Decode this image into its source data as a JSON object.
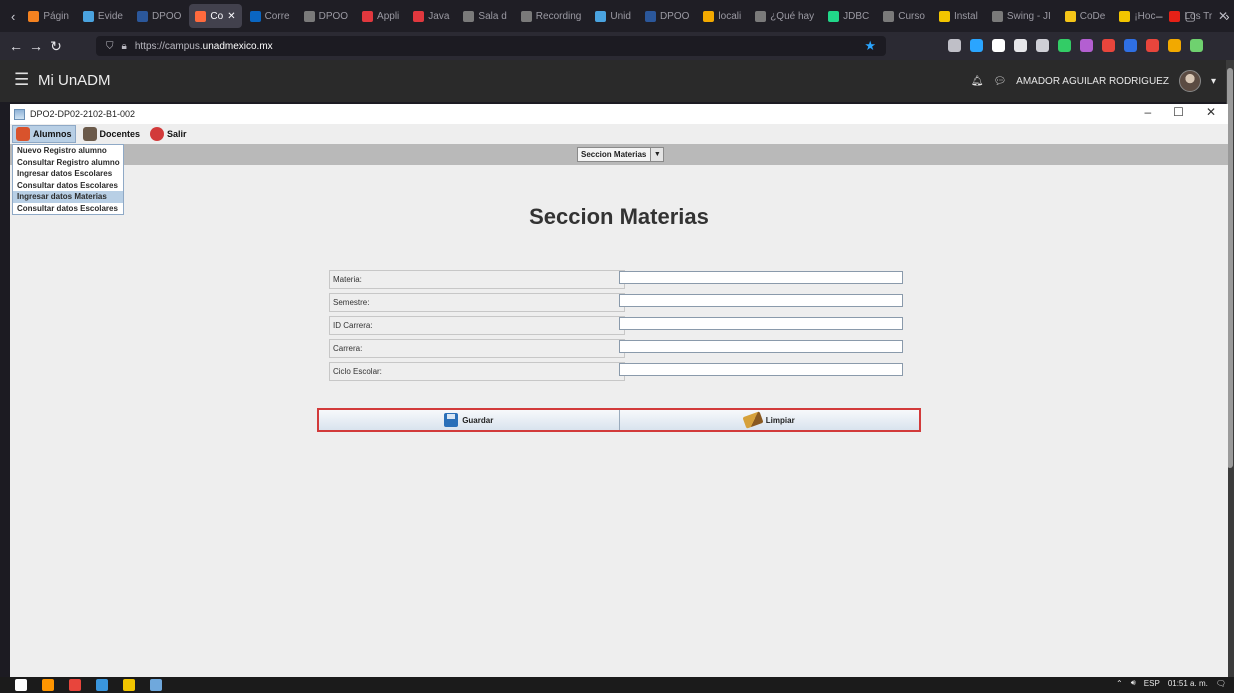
{
  "browser": {
    "tabs": [
      {
        "label": "Págin",
        "color": "#f58220"
      },
      {
        "label": "Evide",
        "color": "#4aa3df"
      },
      {
        "label": "DPOO",
        "color": "#2b579a"
      },
      {
        "label": "Co",
        "color": "#ff6a3d",
        "active": true
      },
      {
        "label": "Corre",
        "color": "#0a66c2"
      },
      {
        "label": "DPOO",
        "color": "#7a7a7a"
      },
      {
        "label": "Appli",
        "color": "#e0383e"
      },
      {
        "label": "Java",
        "color": "#e0383e"
      },
      {
        "label": "Sala d",
        "color": "#7a7a7a"
      },
      {
        "label": "Recording",
        "color": "#7a7a7a"
      },
      {
        "label": "Unid",
        "color": "#4aa3df"
      },
      {
        "label": "DPOO",
        "color": "#2b579a"
      },
      {
        "label": "locali",
        "color": "#f2a900"
      },
      {
        "label": "¿Qué hay",
        "color": "#7a7a7a"
      },
      {
        "label": "JDBC",
        "color": "#21d789"
      },
      {
        "label": "Curso",
        "color": "#7a7a7a"
      },
      {
        "label": "Instal",
        "color": "#f2c500"
      },
      {
        "label": "Swing - JI",
        "color": "#7a7a7a"
      },
      {
        "label": "CoDe",
        "color": "#f5c518"
      },
      {
        "label": "¡Hoc",
        "color": "#f2c500"
      },
      {
        "label": "Los Tr",
        "color": "#e62117"
      }
    ],
    "url_prefix": "https://campus.",
    "url_domain": "unadmexico.mx",
    "ext_colors": [
      "#bfbfc7",
      "#2aa5ff",
      "#ffffff",
      "#e6e6ea",
      "#cfcfd6",
      "#33cc66",
      "#b35fd1",
      "#e8453c",
      "#2f6fe4",
      "#e8453c",
      "#f2a900",
      "#6fd16f"
    ]
  },
  "site": {
    "brand": "Mi UnADM",
    "user_name": "AMADOR AGUILAR RODRIGUEZ"
  },
  "app": {
    "window_title": "DPO2-DP02-2102-B1-002",
    "menus": [
      {
        "label": "Alumnos",
        "color": "#d9532c"
      },
      {
        "label": "Docentes",
        "color": "#6b5a4a"
      },
      {
        "label": "Salir",
        "color": "#d23a3a"
      }
    ],
    "dropdown_items": [
      "Nuevo Registro alumno",
      "Consultar Registro alumno",
      "Ingresar datos Escolares",
      "Consultar datos Escolares",
      "Ingresar datos Materias",
      "Consultar datos Escolares"
    ],
    "selected_item_index": 4,
    "section_select": "Seccion Materias",
    "heading": "Seccion Materias",
    "fields": [
      {
        "label": "Materia:",
        "value": ""
      },
      {
        "label": "Semestre:",
        "value": ""
      },
      {
        "label": "ID Carrera:",
        "value": ""
      },
      {
        "label": "Carrera:",
        "value": ""
      },
      {
        "label": "Ciclo Escolar:",
        "value": ""
      }
    ],
    "buttons": {
      "save": "Guardar",
      "clear": "Limpiar"
    }
  },
  "taskbar": {
    "icons": [
      "#ffffff",
      "#ff9500",
      "#e8453c",
      "#3a96dd",
      "#f2c500",
      "#6fa8dc"
    ],
    "lang": "ESP",
    "time": "01:51 a. m."
  }
}
